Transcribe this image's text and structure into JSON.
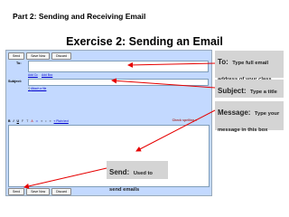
{
  "part_title": "Part 2: Sending and Receiving Email",
  "exercise_title": "Exercise 2: Sending an Email",
  "compose": {
    "buttons": [
      "Send",
      "Save Now",
      "Discard"
    ],
    "to_label": "To:",
    "add_cc": "Add Cc",
    "add_bcc": "Add Bcc",
    "subject_label": "Subject:",
    "attach": "Attach a file",
    "format_controls": [
      "B",
      "I",
      "U"
    ],
    "plain_text": "« Plain text",
    "check_spelling": "Check spelling ▾"
  },
  "callouts": {
    "to": {
      "title": "To:",
      "text": "Type full email address of your class partner"
    },
    "subject": {
      "title": "Subject:",
      "text": "Type a title for your message"
    },
    "message": {
      "title": "Message:",
      "text": "Type your message in this box"
    },
    "send": {
      "title": "Send:",
      "text": "Used to send emails"
    }
  },
  "colors": {
    "arrow": "#e60000",
    "compose_bg": "#c3d9ff",
    "callout_bg": "#d4d4d4"
  }
}
